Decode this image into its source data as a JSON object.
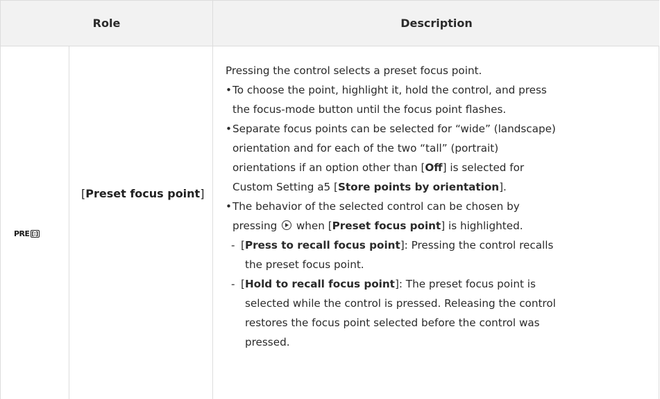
{
  "header": {
    "role": "Role",
    "description": "Description"
  },
  "row": {
    "icon_label": "PRE",
    "icon_box": "[:]",
    "name_bracket_open": "[",
    "name_bold": "Preset focus point",
    "name_bracket_close": "]",
    "desc": {
      "intro": "Pressing the control selects a preset focus point.",
      "b1_l1": "To choose the point, highlight it, hold the control, and press",
      "b1_l2": "the focus-mode button until the focus point flashes.",
      "b2_l1": "Separate focus points can be selected for “wide” (landscape)",
      "b2_l2": "orientation and for each of the two “tall” (portrait)",
      "b2_l3a": "orientations if an option other than [",
      "b2_off": "Off",
      "b2_l3b": "] is selected for",
      "b2_l4a": "Custom Setting a5 [",
      "b2_store": "Store points by orientation",
      "b2_l4b": "].",
      "b3_l1": "The behavior of the selected control can be chosen by",
      "b3_l2a": "pressing",
      "b3_l2b": "when [",
      "b3_preset": "Preset focus point",
      "b3_l2c": "] is highlighted.",
      "s1_open": "[",
      "s1_bold": "Press to recall focus point",
      "s1_rest": "]: Pressing the control recalls",
      "s1_l2": "the preset focus point.",
      "s2_open": "[",
      "s2_bold": "Hold to recall focus point",
      "s2_rest": "]: The preset focus point is",
      "s2_l2": "selected while the control is pressed. Releasing the control",
      "s2_l3": "restores the focus point selected before the control was",
      "s2_l4": "pressed."
    },
    "bullet_char": "•",
    "dash_char": "-"
  }
}
